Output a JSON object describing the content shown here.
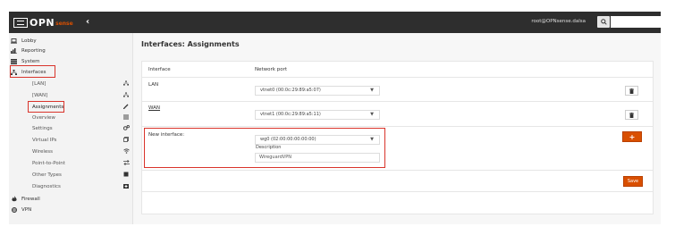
{
  "header": {
    "logo_text": "OPN",
    "logo_sub": "sense",
    "collapse_icon": "‹",
    "user": "root@OPNsense.dalsa",
    "search_icon": "search-icon"
  },
  "sidebar": {
    "items": [
      {
        "label": "Lobby",
        "icon": "laptop-icon"
      },
      {
        "label": "Reporting",
        "icon": "chart-icon"
      },
      {
        "label": "System",
        "icon": "server-icon"
      },
      {
        "label": "Interfaces",
        "icon": "sitemap-icon"
      }
    ],
    "sub_items": [
      {
        "label": "[LAN]",
        "icon": "sitemap-icon"
      },
      {
        "label": "[WAN]",
        "icon": "sitemap-icon"
      },
      {
        "label": "Assignments",
        "icon": "pencil-icon"
      },
      {
        "label": "Overview",
        "icon": "list-icon"
      },
      {
        "label": "Settings",
        "icon": "gears-icon"
      },
      {
        "label": "Virtual IPs",
        "icon": "copy-icon"
      },
      {
        "label": "Wireless",
        "icon": "wifi-icon"
      },
      {
        "label": "Point-to-Point",
        "icon": "exchange-icon"
      },
      {
        "label": "Other Types",
        "icon": "stop-icon"
      },
      {
        "label": "Diagnostics",
        "icon": "medkit-icon"
      }
    ],
    "bottom_items": [
      {
        "label": "Firewall",
        "icon": "fire-icon"
      },
      {
        "label": "VPN",
        "icon": "globe-icon"
      }
    ]
  },
  "main": {
    "title": "Interfaces: Assignments",
    "table": {
      "col_interface": "Interface",
      "col_network_port": "Network port",
      "rows": [
        {
          "interface": "LAN",
          "port": "vtnet0 (00:0c:29:89:a5:07)"
        },
        {
          "interface": "WAN",
          "port": "vtnet1 (00:0c:29:89:a5:11)"
        }
      ],
      "new_row": {
        "label": "New interface:",
        "port": "wg0 (02:00:00:00:00:00)",
        "desc_label": "Description",
        "desc_value": "WireguardVPN"
      }
    },
    "add_label": "+",
    "save_label": "Save"
  },
  "colors": {
    "accent": "#d94f00",
    "highlight": "#d9342b",
    "topbar": "#2e2e2e"
  }
}
